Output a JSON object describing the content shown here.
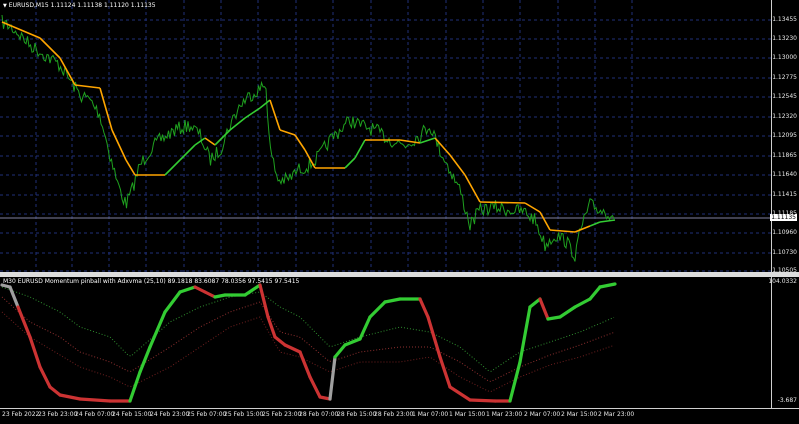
{
  "main_chart": {
    "caret": "▼",
    "title": "EURUSD,M15  1.11124 1.11138 1.11120 1.11135",
    "current_price": "1.11135",
    "price_ticks": [
      "1.13455",
      "1.13230",
      "1.13000",
      "1.12775",
      "1.12545",
      "1.12320",
      "1.12095",
      "1.11865",
      "1.11640",
      "1.11415",
      "1.11185",
      "1.10960",
      "1.10730",
      "1.10505"
    ],
    "colors": {
      "price": "#1fa11f",
      "line": "#ffa500",
      "grid": "#1f2f78"
    }
  },
  "indicator": {
    "title": "M30 EURUSD Momentum pinball with Adxvma (25,10) 89.1818 83.6087 78.0356 97.5415 97.5415",
    "top_value": "104.0332",
    "bottom_value": "-3.687",
    "colors": {
      "up": "#33cc33",
      "down": "#cc3333",
      "neutral": "#a0a0a0"
    }
  },
  "time_labels": [
    "23 Feb 2022",
    "23 Feb 23:00",
    "24 Feb 07:00",
    "24 Feb 15:00",
    "24 Feb 23:00",
    "25 Feb 07:00",
    "25 Feb 15:00",
    "25 Feb 23:00",
    "28 Feb 07:00",
    "28 Feb 15:00",
    "28 Feb 23:00",
    "1 Mar 07:00",
    "1 Mar 15:00",
    "1 Mar 23:00",
    "2 Mar 07:00",
    "2 Mar 15:00",
    "2 Mar 23:00"
  ]
}
